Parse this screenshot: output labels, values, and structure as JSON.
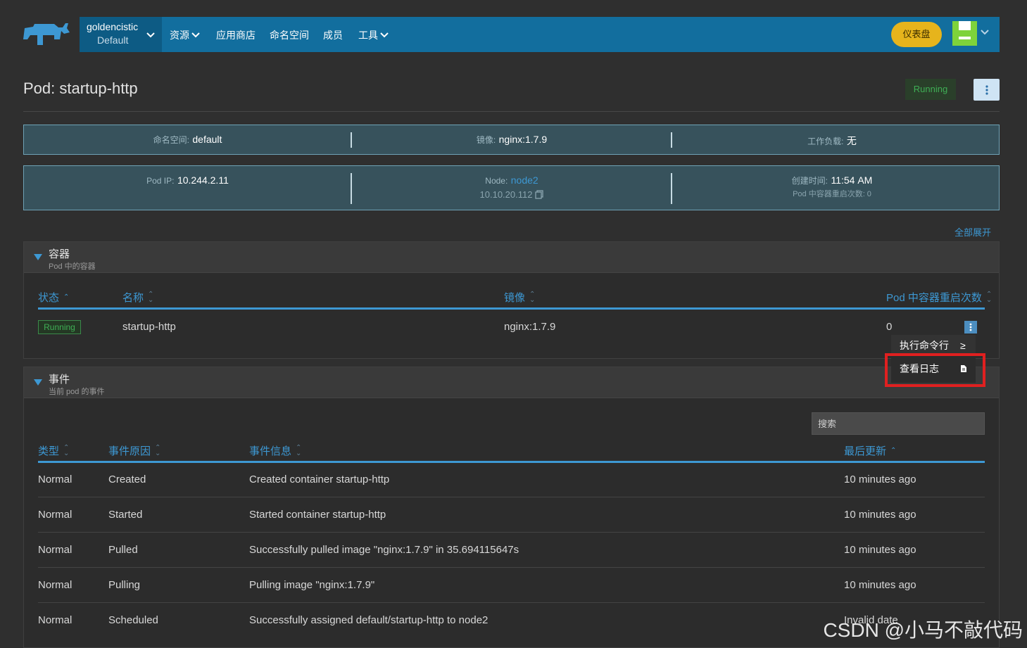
{
  "nav": {
    "cluster_name": "goldencistic",
    "project_name": "Default",
    "items": [
      {
        "label": "资源",
        "has_dropdown": true
      },
      {
        "label": "应用商店",
        "has_dropdown": false
      },
      {
        "label": "命名空间",
        "has_dropdown": false
      },
      {
        "label": "成员",
        "has_dropdown": false
      },
      {
        "label": "工具",
        "has_dropdown": true
      }
    ],
    "dashboard_button": "仪表盘"
  },
  "header": {
    "title": "Pod: startup-http",
    "status": "Running"
  },
  "info1": {
    "namespace_label": "命名空间:",
    "namespace_value": "default",
    "image_label": "镜像:",
    "image_value": "nginx:1.7.9",
    "workload_label": "工作负载:",
    "workload_value": "无"
  },
  "info2": {
    "pod_ip_label": "Pod IP:",
    "pod_ip_value": "10.244.2.11",
    "node_label": "Node:",
    "node_value": "node2",
    "node_ip": "10.10.20.112",
    "created_label": "创建时间:",
    "created_value": "11:54 AM",
    "restart_label": "Pod 中容器重启次数: 0"
  },
  "expand_all": "全部展开",
  "containers": {
    "title": "容器",
    "subtitle": "Pod 中的容器",
    "columns": [
      "状态",
      "名称",
      "镜像",
      "Pod 中容器重启次数"
    ],
    "row": {
      "status": "Running",
      "name": "startup-http",
      "image": "nginx:1.7.9",
      "restarts": "0"
    },
    "menu": {
      "exec": "执行命令行",
      "exec_icon": "≥",
      "logs": "查看日志"
    }
  },
  "events": {
    "title": "事件",
    "subtitle": "当前 pod 的事件",
    "search_placeholder": "搜索",
    "columns": [
      "类型",
      "事件原因",
      "事件信息",
      "最后更新"
    ],
    "rows": [
      {
        "type": "Normal",
        "reason": "Created",
        "message": "Created container startup-http",
        "updated": "10 minutes ago"
      },
      {
        "type": "Normal",
        "reason": "Started",
        "message": "Started container startup-http",
        "updated": "10 minutes ago"
      },
      {
        "type": "Normal",
        "reason": "Pulled",
        "message": "Successfully pulled image \"nginx:1.7.9\" in 35.694115647s",
        "updated": "10 minutes ago"
      },
      {
        "type": "Normal",
        "reason": "Pulling",
        "message": "Pulling image \"nginx:1.7.9\"",
        "updated": "10 minutes ago"
      },
      {
        "type": "Normal",
        "reason": "Scheduled",
        "message": "Successfully assigned default/startup-http to node2",
        "updated": "Invalid date"
      }
    ]
  },
  "watermark": "CSDN @小马不敲代码",
  "colors": {
    "nav_bg": "#126e9e",
    "accent": "#3d98d3",
    "running": "#3fae55",
    "dashboard": "#e6b41c",
    "highlight": "#e02020"
  }
}
